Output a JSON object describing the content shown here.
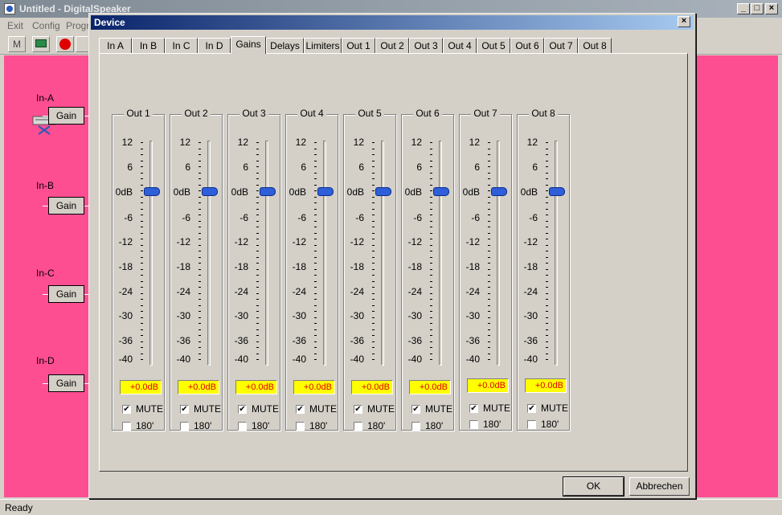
{
  "main_window": {
    "title": "Untitled - DigitalSpeaker",
    "menu": [
      "Exit",
      "Config",
      "Progr..."
    ],
    "status": "Ready"
  },
  "canvas": {
    "inputs": [
      {
        "label": "In-A",
        "block": "Gain"
      },
      {
        "label": "In-B",
        "block": "Gain"
      },
      {
        "label": "In-C",
        "block": "Gain"
      },
      {
        "label": "In-D",
        "block": "Gain"
      }
    ]
  },
  "dialog": {
    "title": "Device",
    "tabs": [
      "In A",
      "In B",
      "In C",
      "In D",
      "Gains",
      "Delays",
      "Limiters",
      "Out 1",
      "Out 2",
      "Out 3",
      "Out 4",
      "Out 5",
      "Out 6",
      "Out 7",
      "Out 8"
    ],
    "active_tab": "Gains",
    "scale_labels": [
      "12",
      "6",
      "0dB",
      "-6",
      "-12",
      "-18",
      "-24",
      "-30",
      "-36",
      "-40"
    ],
    "channels": [
      {
        "name": "Out 1",
        "value": "+0.0dB",
        "mute_label": "MUTE",
        "mute": true,
        "phase_label": "180'",
        "phase": false
      },
      {
        "name": "Out 2",
        "value": "+0.0dB",
        "mute_label": "MUTE",
        "mute": true,
        "phase_label": "180'",
        "phase": false
      },
      {
        "name": "Out 3",
        "value": "+0.0dB",
        "mute_label": "MUTE",
        "mute": true,
        "phase_label": "180'",
        "phase": false
      },
      {
        "name": "Out 4",
        "value": "+0.0dB",
        "mute_label": "MUTE",
        "mute": true,
        "phase_label": "180'",
        "phase": false
      },
      {
        "name": "Out 5",
        "value": "+0.0dB",
        "mute_label": "MUTE",
        "mute": true,
        "phase_label": "180'",
        "phase": false
      },
      {
        "name": "Out 6",
        "value": "+0.0dB",
        "mute_label": "MUTE",
        "mute": true,
        "phase_label": "180'",
        "phase": false
      },
      {
        "name": "Out 7",
        "value": "+0.0dB",
        "mute_label": "MUTE",
        "mute": true,
        "phase_label": "180'",
        "phase": false
      },
      {
        "name": "Out 8",
        "value": "+0.0dB",
        "mute_label": "MUTE",
        "mute": true,
        "phase_label": "180'",
        "phase": false
      }
    ],
    "ok_label": "OK",
    "cancel_label": "Abbrechen"
  },
  "colors": {
    "canvas": "#fe4e92",
    "value_bg": "#ffff00",
    "value_text": "#e00000",
    "thumb": "#2e5fd8",
    "dialog_title": "#0a246a"
  },
  "icons": [
    "app-icon",
    "minimize-icon",
    "maximize-icon",
    "close-icon",
    "record-icon",
    "device-icon"
  ]
}
